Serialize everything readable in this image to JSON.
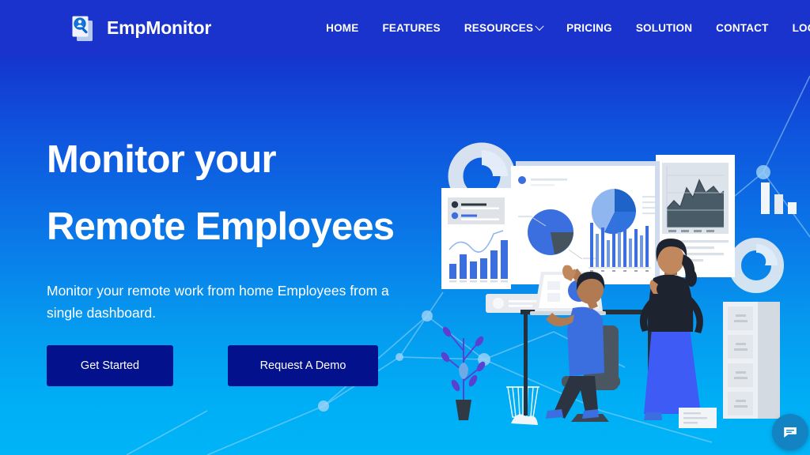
{
  "brand": {
    "name": "EmpMonitor",
    "logo_icon": "document-magnifier-person-icon"
  },
  "nav": {
    "items": [
      {
        "label": "HOME",
        "has_dropdown": false,
        "name": "nav-home"
      },
      {
        "label": "FEATURES",
        "has_dropdown": false,
        "name": "nav-features"
      },
      {
        "label": "RESOURCES",
        "has_dropdown": true,
        "name": "nav-resources"
      },
      {
        "label": "PRICING",
        "has_dropdown": false,
        "name": "nav-pricing"
      },
      {
        "label": "SOLUTION",
        "has_dropdown": false,
        "name": "nav-solution"
      },
      {
        "label": "CONTACT",
        "has_dropdown": false,
        "name": "nav-contact"
      },
      {
        "label": "LOGIN/SIGNUP",
        "has_dropdown": false,
        "name": "nav-login-signup"
      }
    ]
  },
  "hero": {
    "headline_line1": "Monitor your",
    "headline_line2": "Remote Employees",
    "subtitle": "Monitor your remote work from home Employees from a single dashboard.",
    "primary_cta": "Get Started",
    "secondary_cta": "Request A Demo"
  },
  "chat": {
    "icon": "chat-bubble-icon",
    "label": "Chat"
  },
  "colors": {
    "header_bg": "#1a33cc",
    "gradient_top": "#1a33cc",
    "gradient_bottom": "#00b4f7",
    "button_bg": "#03118c",
    "text_on_blue": "#ffffff",
    "accent_blue": "#3b6fe0",
    "chat_bg": "#1383c4"
  },
  "illustration": {
    "name": "remote-team-analytics-illustration",
    "elements": [
      "dashboard-panel-left",
      "dashboard-panel-center",
      "dashboard-panel-right",
      "donut-ring-large",
      "donut-ring-small",
      "bar-chart-floating",
      "man-at-desk-with-laptop",
      "woman-standing-pointing",
      "filing-cabinet",
      "potted-plant",
      "waste-basket",
      "keyboard"
    ]
  }
}
